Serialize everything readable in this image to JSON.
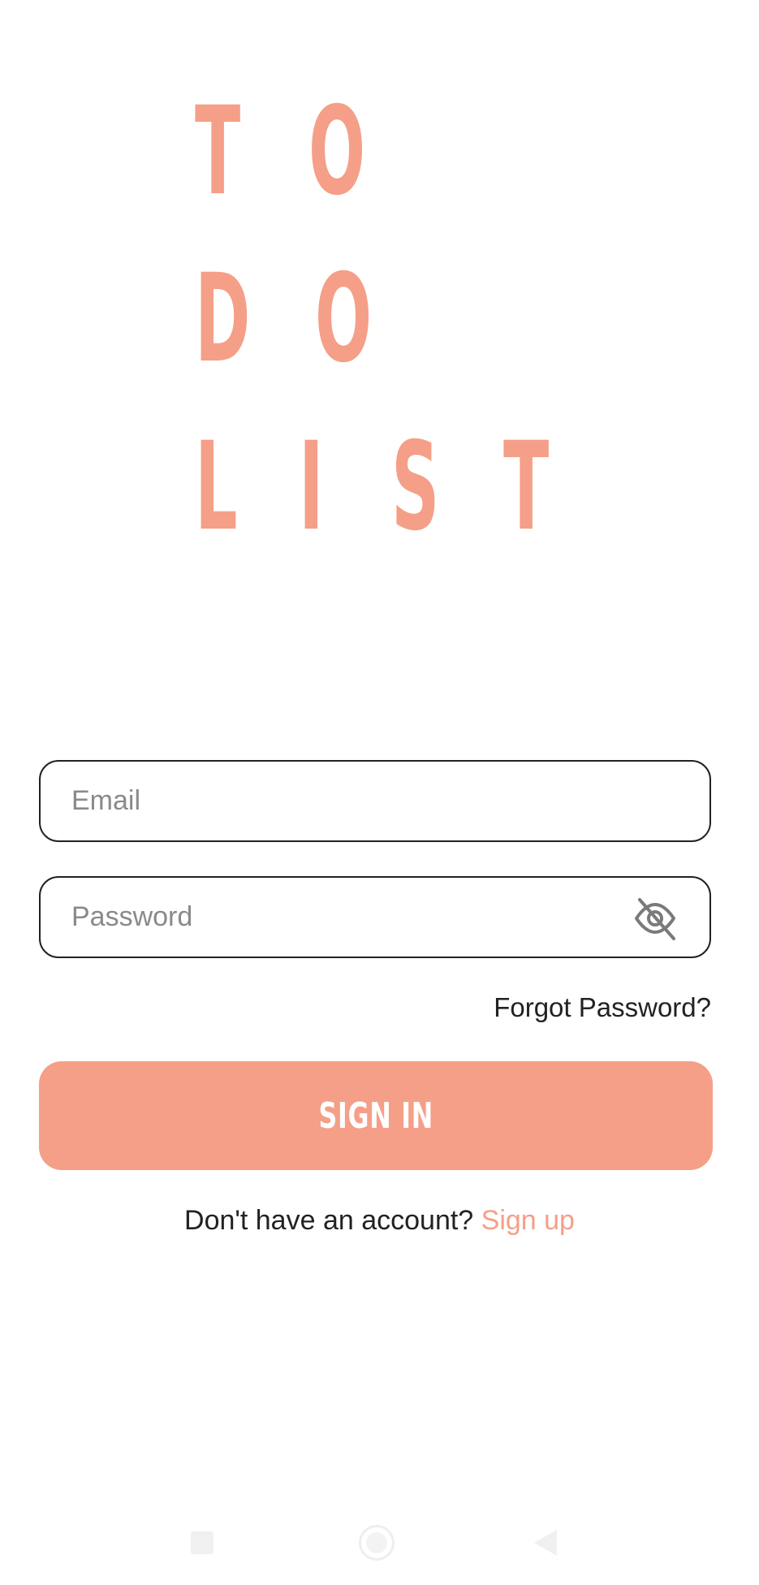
{
  "logo": {
    "letters": [
      "T",
      "O",
      "D",
      "O",
      "L",
      "I",
      "S",
      "T"
    ]
  },
  "form": {
    "email_placeholder": "Email",
    "password_placeholder": "Password",
    "password_visibility_icon": "eye-off-icon",
    "forgot_password": "Forgot Password?",
    "sign_in": "SIGN IN"
  },
  "signup": {
    "prompt": "Don't have an account? ",
    "link": "Sign up"
  },
  "colors": {
    "accent": "#F59F88",
    "text": "#222222",
    "placeholder": "#8a8a8a"
  },
  "navbar": {
    "icons": [
      "recents-square-icon",
      "home-circle-icon",
      "back-triangle-icon"
    ]
  }
}
